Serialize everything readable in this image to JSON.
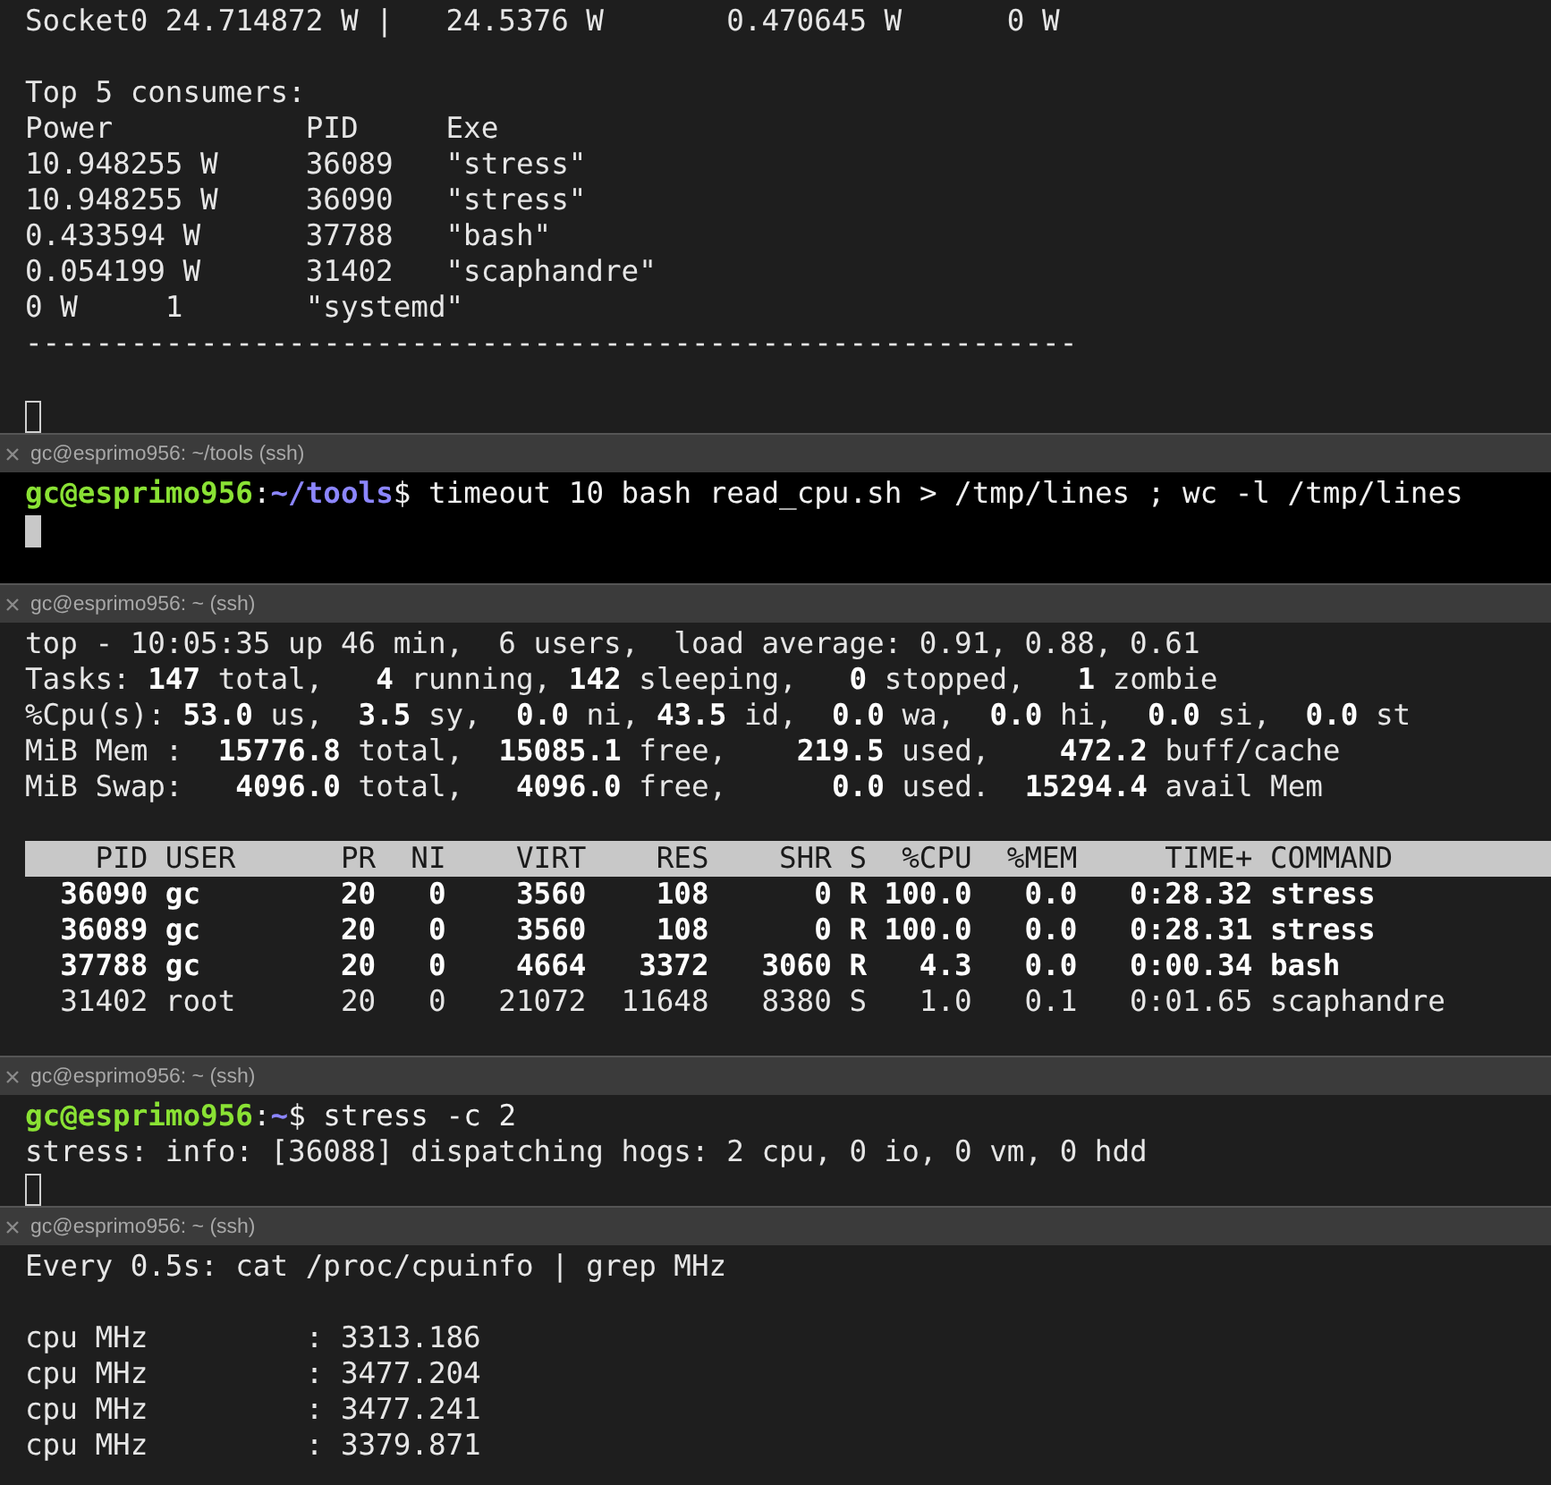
{
  "panes": [
    {
      "active": false,
      "cursor": {
        "filled": false
      },
      "lines": [
        {
          "kind": "text",
          "text": "Socket0 24.714872 W |   24.5376 W       0.470645 W      0 W"
        },
        {
          "kind": "blank"
        },
        {
          "kind": "text",
          "text": "Top 5 consumers:"
        },
        {
          "kind": "text",
          "text": "Power           PID     Exe"
        },
        {
          "kind": "text",
          "text": "10.948255 W     36089   \"stress\""
        },
        {
          "kind": "text",
          "text": "10.948255 W     36090   \"stress\""
        },
        {
          "kind": "text",
          "text": "0.433594 W      37788   \"bash\""
        },
        {
          "kind": "text",
          "text": "0.054199 W      31402   \"scaphandre\""
        },
        {
          "kind": "text",
          "text": "0 W     1       \"systemd\""
        },
        {
          "kind": "text",
          "text": "------------------------------------------------------------"
        },
        {
          "kind": "blank"
        }
      ]
    },
    {
      "title": "gc@esprimo956: ~/tools (ssh)",
      "active": true,
      "cursor": {
        "filled": true
      },
      "lines": [
        {
          "kind": "prompt",
          "segments": [
            {
              "kind": "user",
              "text": "gc@esprimo956"
            },
            {
              "kind": "plain",
              "text": ":"
            },
            {
              "kind": "path",
              "text": "~/tools"
            },
            {
              "kind": "plain",
              "text": "$ timeout 10 bash read_cpu.sh > /tmp/lines ; wc -l /tmp/lines"
            }
          ]
        }
      ],
      "trailing": {
        "kind": "blank"
      }
    },
    {
      "title": "gc@esprimo956: ~ (ssh)",
      "active": false,
      "lines": [
        {
          "kind": "text",
          "text": "top - 10:05:35 up 46 min,  6 users,  load average: 0.91, 0.88, 0.61"
        },
        {
          "kind": "text",
          "text": "Tasks: **147** total,   **4** running, **142** sleeping,   **0** stopped,   **1** zombie"
        },
        {
          "kind": "text",
          "text": "%Cpu(s): **53.0** us,  **3.5** sy,  **0.0** ni, **43.5** id,  **0.0** wa,  **0.0** hi,  **0.0** si,  **0.0** st"
        },
        {
          "kind": "text",
          "text": "MiB Mem :  **15776.8** total,  **15085.1** free,    **219.5** used,    **472.2** buff/cache"
        },
        {
          "kind": "text",
          "text": "MiB Swap:   **4096.0** total,   **4096.0** free,      **0.0** used.  **15294.4** avail Mem"
        },
        {
          "kind": "blank"
        },
        {
          "kind": "header",
          "text": "    PID USER      PR  NI    VIRT    RES    SHR S  %CPU  %MEM     TIME+ COMMAND"
        },
        {
          "kind": "bold",
          "text": "  36090 gc        20   0    3560    108      0 R 100.0   0.0   0:28.32 stress"
        },
        {
          "kind": "bold",
          "text": "  36089 gc        20   0    3560    108      0 R 100.0   0.0   0:28.31 stress"
        },
        {
          "kind": "bold",
          "text": "  37788 gc        20   0    4664   3372   3060 R   4.3   0.0   0:00.34 bash"
        },
        {
          "kind": "text",
          "text": "  31402 root      20   0   21072  11648   8380 S   1.0   0.1   0:01.65 scaphandre"
        },
        {
          "kind": "blank"
        }
      ]
    },
    {
      "title": "gc@esprimo956: ~ (ssh)",
      "active": false,
      "cursor": {
        "filled": false
      },
      "lines": [
        {
          "kind": "prompt",
          "segments": [
            {
              "kind": "user",
              "text": "gc@esprimo956"
            },
            {
              "kind": "plain",
              "text": ":"
            },
            {
              "kind": "path",
              "text": "~"
            },
            {
              "kind": "plain",
              "text": "$ stress -c 2"
            }
          ]
        },
        {
          "kind": "text",
          "text": "stress: info: [36088] dispatching hogs: 2 cpu, 0 io, 0 vm, 0 hdd"
        }
      ]
    },
    {
      "title": "gc@esprimo956: ~ (ssh)",
      "active": false,
      "lines": [
        {
          "kind": "text",
          "text": "Every 0.5s: cat /proc/cpuinfo | grep MHz"
        },
        {
          "kind": "blank"
        },
        {
          "kind": "text",
          "text": "cpu MHz         : 3313.186"
        },
        {
          "kind": "text",
          "text": "cpu MHz         : 3477.204"
        },
        {
          "kind": "text",
          "text": "cpu MHz         : 3477.241"
        },
        {
          "kind": "text",
          "text": "cpu MHz         : 3379.871"
        }
      ]
    }
  ]
}
